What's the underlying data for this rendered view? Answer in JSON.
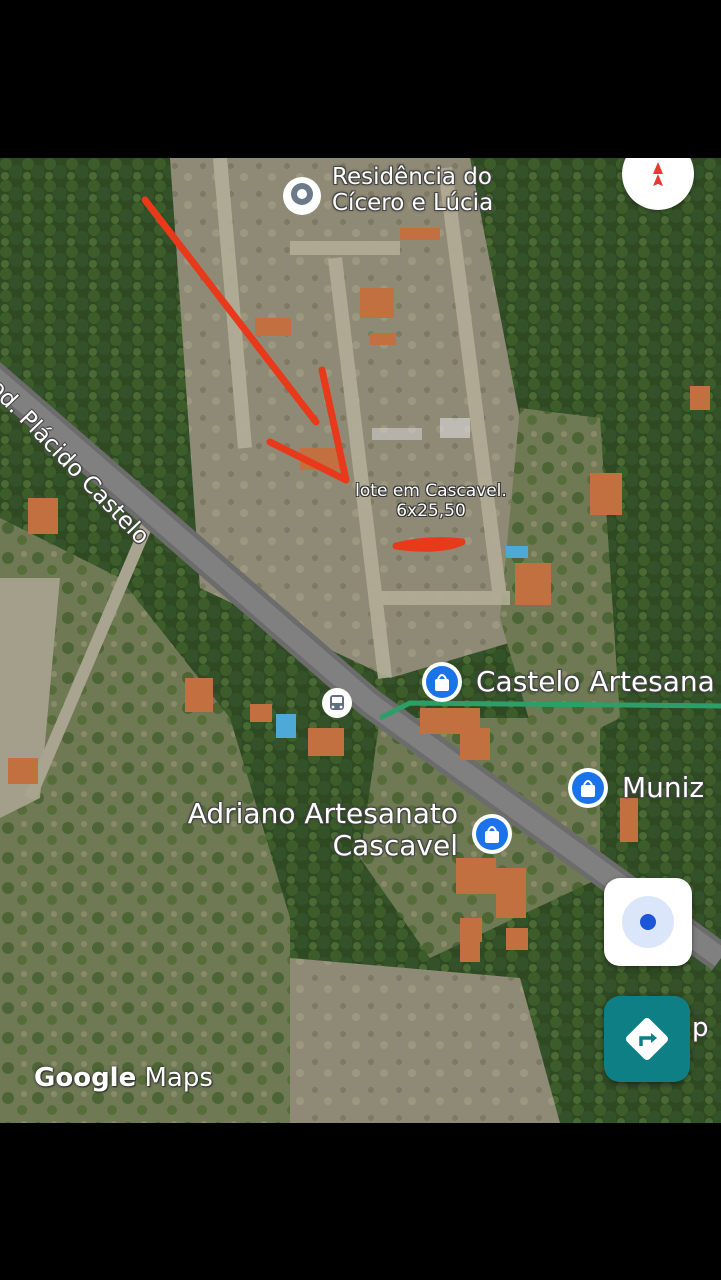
{
  "map": {
    "provider_logo": "Google",
    "provider_product": "Maps",
    "compass_icon": "compass-icon",
    "places": [
      {
        "lines": [
          "Residência do",
          "Cícero e Lúcia"
        ],
        "icon": "location-pin-icon"
      },
      {
        "lines": [
          "Castelo Artesana"
        ],
        "icon": "shopping-bag-pin-icon"
      },
      {
        "lines": [
          "Muniz"
        ],
        "icon": "shopping-bag-pin-icon"
      },
      {
        "lines": [
          "Adriano Artesanato",
          "Cascavel"
        ],
        "icon": "shopping-bag-pin-icon"
      }
    ],
    "road_label": "Rod. Plácido Castelo",
    "partial_text_right": "p",
    "bus_stop_icon": "bus-icon",
    "annotation": {
      "line1": "lote em Cascavel.",
      "line2": "6x25,50",
      "arrow_color": "#e8391b"
    },
    "buttons": {
      "my_location": "my-location-icon",
      "directions": "directions-icon"
    },
    "colors": {
      "accent_blue": "#1a73e8",
      "directions_teal": "#0f7f86",
      "route_line": "#2e9e68"
    }
  }
}
